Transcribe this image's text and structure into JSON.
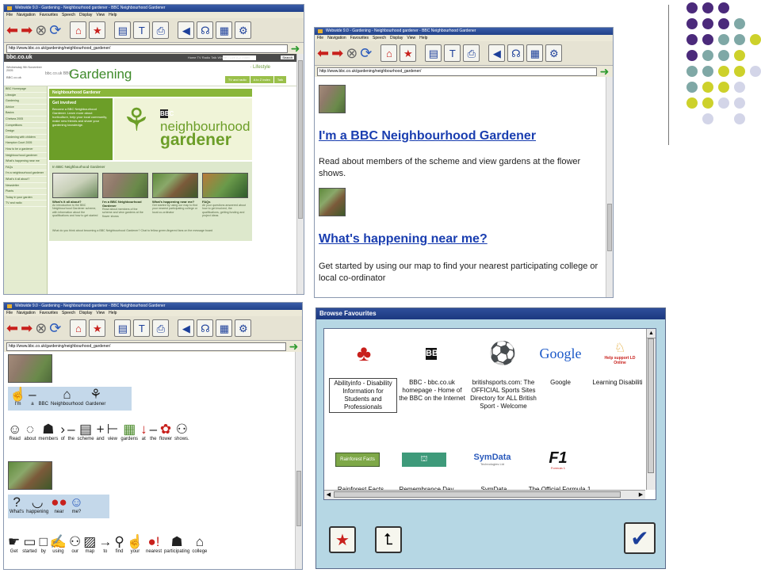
{
  "browser": {
    "window_title": "Webwide 9.0 - Gardening - Neighbourhood gardener - BBC Neighbourhood Gardener",
    "menu": [
      "File",
      "Navigation",
      "Favourites",
      "Speech",
      "Display",
      "View",
      "Help"
    ],
    "address": "http://www.bbc.co.uk/gardening/neighbourhood_gardener/"
  },
  "bbc_page": {
    "site": "bbc.co.uk",
    "nav": "Home   TV   Radio   Talk   Where I Live   A-Z Index",
    "search_button": "Search",
    "date_line": "Wednesday 9th November 2005",
    "location": "BBC.co.uk",
    "small_brand": "bbc.co.uk BBCi",
    "title": "Gardening",
    "lifestyle": "· Lifestyle",
    "tabs": [
      "TV and radio",
      "A to Z index",
      "Talk"
    ],
    "sidenav": [
      "BBC Homepage",
      "Lifestyle",
      "Gardening",
      "Advice",
      "Basics",
      "Chelsea 2005",
      "Competitions",
      "Design",
      "Gardening with children",
      "Hampton Court 2005",
      "How to be a gardener",
      "Neighbourhood gardener",
      "What's happening near me",
      "FAQs",
      "I'm a neighbourhood gardener",
      "What's it all about?",
      "Newsletter",
      "Plants",
      "Today in your garden",
      "TV and radio"
    ],
    "section_head": "Neighbourhood Gardener",
    "get_involved_title": "Get involved",
    "get_involved_text": "Become a BBC Neighbourhood Gardener. Learn more about horticulture, help your local community, make new friends and share your gardening knowledge.",
    "hero_brand": "BBC",
    "hero_line1": "neighbourhood",
    "hero_line2": "gardener",
    "in_bbc_title": "In BBC Neighbourhood Gardener",
    "items": [
      {
        "title": "What's it all about?",
        "text": "An introduction to the BBC Neighbourhood Gardener scheme, with information about the qualifications and how to get started"
      },
      {
        "title": "I'm a BBC Neighbourhood Gardener",
        "text": "Read about members of the scheme and view gardens at the flower shows"
      },
      {
        "title": "What's happening near me?",
        "text": "Get started by using our map to find your nearest participating college or local co-ordinator"
      },
      {
        "title": "FAQs",
        "text": "All your questions answered about how to get involved, the qualifications, getting funding and project ideas"
      }
    ],
    "footer_text": "What do you think about becoming a BBC Neighbourhood Gardener? Chat to fellow green-fingered fans on the message board",
    "footer_link": "TV and radio"
  },
  "text_page": {
    "link1": "I'm a BBC Neighbourhood Gardener",
    "para1": "Read about members of the scheme and view gardens at the flower shows.",
    "link2": "What's happening near me?",
    "para2": "Get started by using our map to find your nearest participating college or local co-ordinator"
  },
  "symbol_page": {
    "heading1_words": [
      "I'm",
      "a",
      "BBC",
      "Neighbourhood",
      "Gardener"
    ],
    "sentence1_words": [
      "Read",
      "about",
      "members",
      "of",
      "the",
      "scheme",
      "and",
      "view",
      "gardens",
      "at",
      "the",
      "flower",
      "shows."
    ],
    "heading2_words": [
      "What's",
      "happening",
      "near",
      "me?"
    ],
    "sentence2_words": [
      "Get",
      "started",
      "by",
      "using",
      "our",
      "map",
      "to",
      "find",
      "your",
      "nearest",
      "participating",
      "college"
    ]
  },
  "favourites": {
    "title": "Browse Favourites",
    "items": [
      {
        "label": "Abilityinfo - Disability Information for Students and Professionals",
        "icon": "abilityinfo-logo"
      },
      {
        "label": "BBC - bbc.co.uk homepage - Home of the BBC on the Internet",
        "icon": "bbc-logo"
      },
      {
        "label": "britishsports.com: The OFFICIAL Sports Sites Directory for ALL British Sport - Welcome",
        "icon": "sports-logo"
      },
      {
        "label": "Google",
        "icon": "google-logo"
      },
      {
        "label": "Learning Disabiliti",
        "icon": "learning-disabilities-logo"
      },
      {
        "label": "Rainforest Facts",
        "icon": "rainforest-logo"
      },
      {
        "label": "Remembrance Day Tradition",
        "icon": "remembrance-logo"
      },
      {
        "label": "SymData Technologies Ltd",
        "icon": "symdata-logo"
      },
      {
        "label": "The Official Formula 1 Website",
        "icon": "f1-logo"
      }
    ],
    "logo_text": {
      "bbc": "BBC",
      "google": "Google",
      "learning": "Help support LD Online",
      "rainforest": "Rainforest Facts",
      "symdata": "SymData",
      "symdata_sub": "Technologies Ltd",
      "f1": "F1",
      "f1_sub": "Formula 1"
    }
  },
  "colors": {
    "dot_purple": "#4b2a7b",
    "dot_teal": "#7fa8a6",
    "dot_yellow": "#cdd12b",
    "dot_lavender": "#d3d5e8"
  }
}
